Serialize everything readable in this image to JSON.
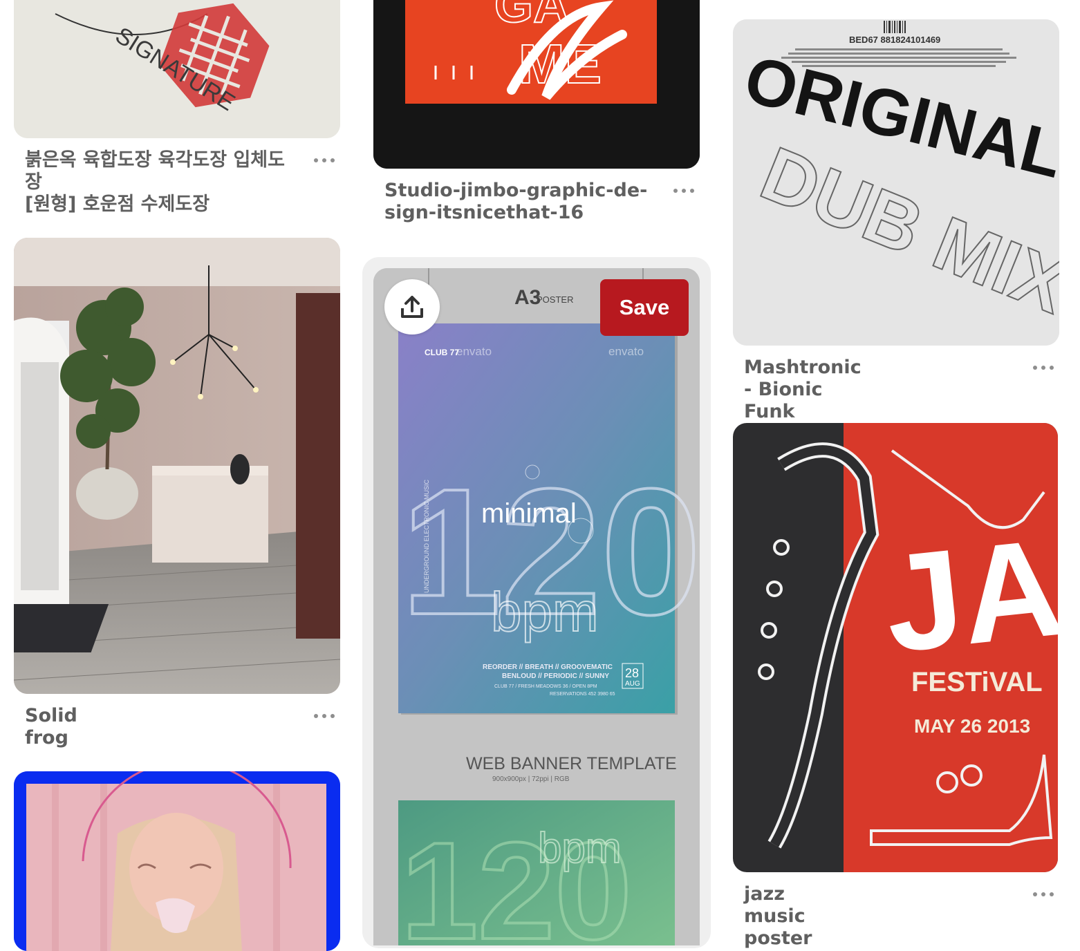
{
  "pins": [
    {
      "title_line1": "붉은옥 육합도장 육각도장 입체도장",
      "title_line2": "[원형] 호운점 수제도장",
      "image_text": "SIGNATURE"
    },
    {
      "title_line1": "Studio-jimbo-graphic-de-",
      "title_line2": "sign-itsnicethat-16",
      "image_text_1": "GA",
      "image_text_2": "ME"
    },
    {
      "title": "Mashtronic - Bionic Funk",
      "barcode_text": "BED67 881824101469",
      "image_text_1": "ORIGINAL",
      "image_text_2": "DUB MIX"
    },
    {
      "title": "Solid frog"
    },
    {
      "save_label": "Save",
      "poster": {
        "header": "A3",
        "header_small": "POSTER",
        "brand": "envato",
        "club": "CLUB 77",
        "big_number": "120",
        "name": "minimal",
        "unit": "bpm",
        "lineup_1": "REORDER // BREATH // GROOVEMATIC",
        "lineup_2": "BENLOUD // PERIODIC // SUNNY",
        "venue": "CLUB 77 / FRESH MEADOWS 36 / OPEN 8PM",
        "reservations": "RESERVATIONS 452 3980 65",
        "day": "28",
        "month": "AUG",
        "side_text": "UNDERGROUND ELECTRONIC MUSIC",
        "banner_title": "WEB BANNER TEMPLATE",
        "banner_sub": "900x900px | 72ppi | RGB"
      }
    },
    {
      "title": "jazz music poster",
      "image_text_1": "JAZZ",
      "image_text_2": "FESTiVAL",
      "image_text_3": "MAY 26 2013"
    }
  ]
}
